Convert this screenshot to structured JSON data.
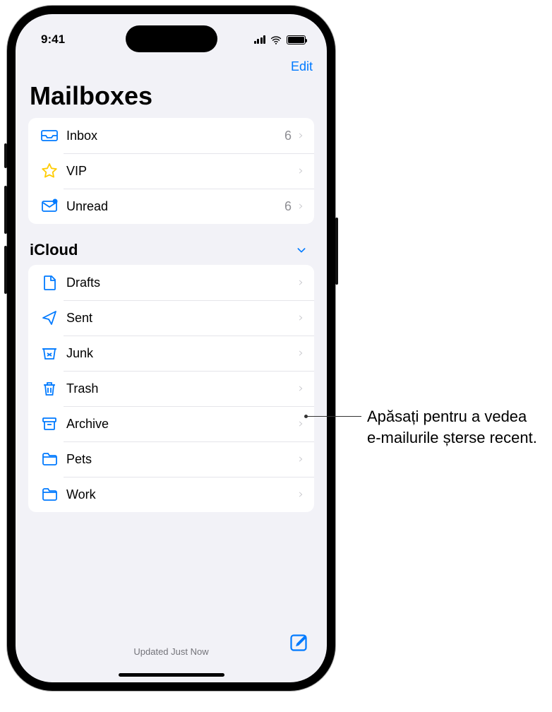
{
  "status_bar": {
    "time": "9:41"
  },
  "nav": {
    "edit": "Edit"
  },
  "title": "Mailboxes",
  "favorites": [
    {
      "icon": "inbox",
      "label": "Inbox",
      "count": "6"
    },
    {
      "icon": "star",
      "label": "VIP",
      "count": ""
    },
    {
      "icon": "unread",
      "label": "Unread",
      "count": "6"
    }
  ],
  "section": {
    "title": "iCloud"
  },
  "icloud_boxes": [
    {
      "icon": "draft",
      "label": "Drafts"
    },
    {
      "icon": "sent",
      "label": "Sent"
    },
    {
      "icon": "junk",
      "label": "Junk"
    },
    {
      "icon": "trash",
      "label": "Trash"
    },
    {
      "icon": "archive",
      "label": "Archive"
    },
    {
      "icon": "folder",
      "label": "Pets"
    },
    {
      "icon": "folder",
      "label": "Work"
    }
  ],
  "toolbar": {
    "status": "Updated Just Now"
  },
  "callout": {
    "text": "Apăsați pentru a vedea e‑mailurile șterse recent."
  }
}
